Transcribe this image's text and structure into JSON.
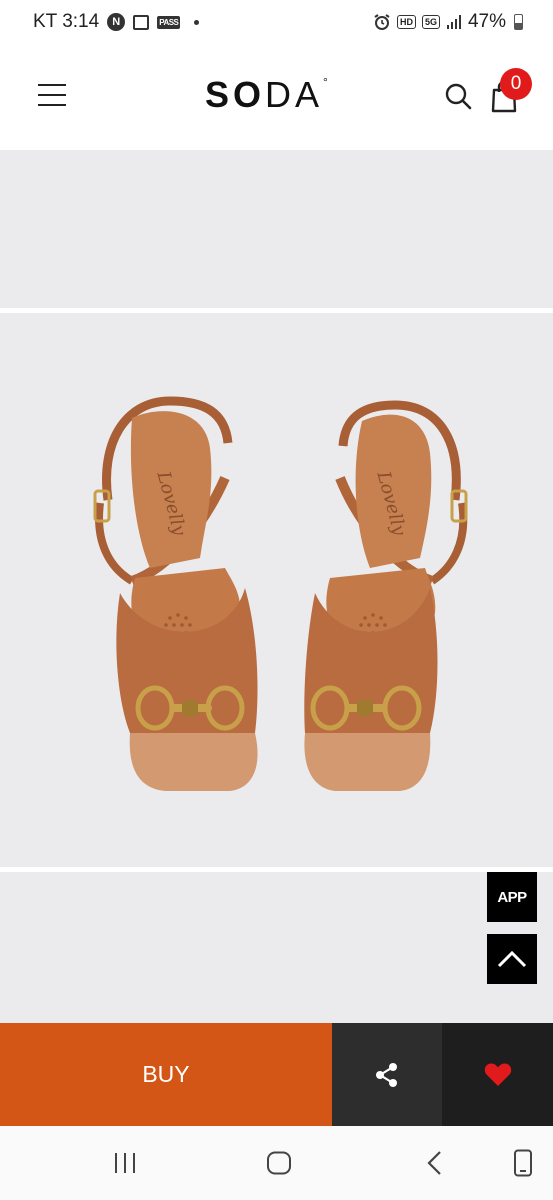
{
  "status_bar": {
    "time": "KT 3:14",
    "badge_n": "N",
    "badge_pass": "PASS",
    "hd": "HD",
    "network": "5G",
    "battery": "47%"
  },
  "header": {
    "logo_bold": "SO",
    "logo_light": "DA",
    "logo_mark": "°",
    "cart_count": "0"
  },
  "product": {
    "insole_text": "Lovelly",
    "colors": {
      "leather": "#b86c40",
      "leather_dark": "#9c5530",
      "hardware": "#c9a04a",
      "background": "#ebebed"
    }
  },
  "floating": {
    "app_label": "APP"
  },
  "actions": {
    "buy_label": "BUY",
    "buy_color": "#d35616",
    "wish_color": "#e11b1b"
  }
}
